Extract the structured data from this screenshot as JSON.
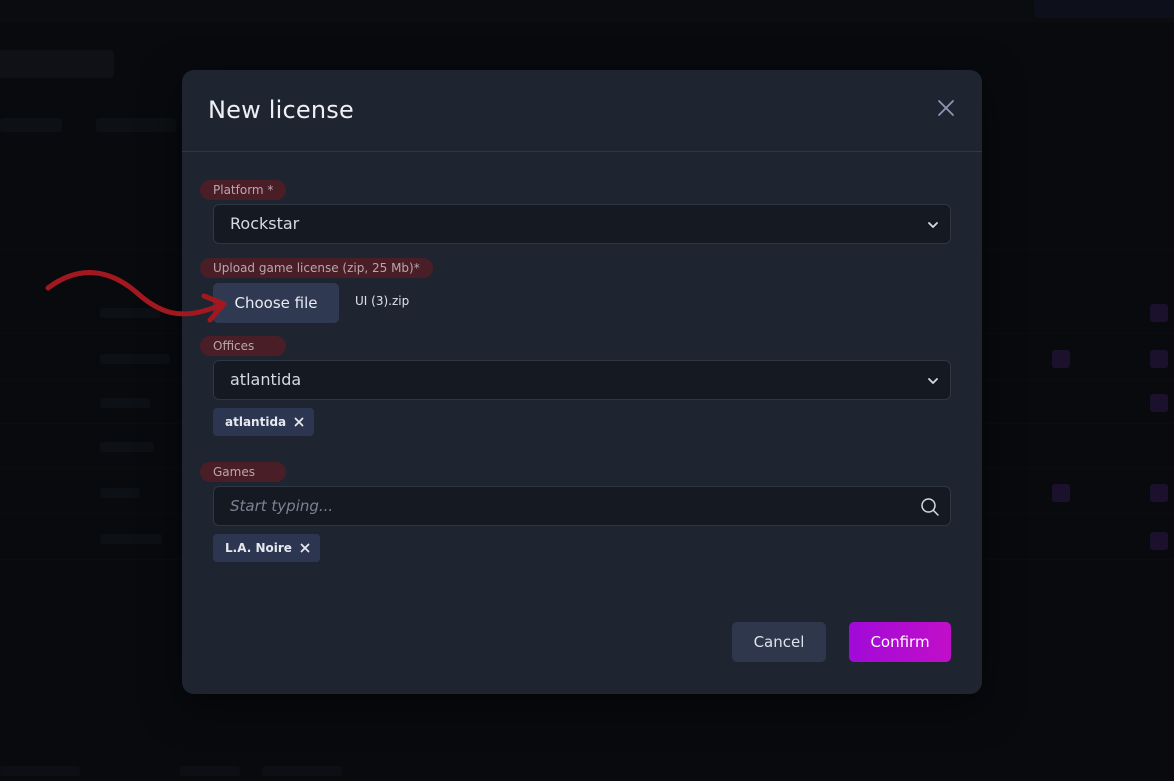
{
  "modal": {
    "title": "New license",
    "platform": {
      "label": "Platform *",
      "value": "Rockstar"
    },
    "upload": {
      "label": "Upload game license (zip, 25 Mb)*",
      "button_label": "Choose file",
      "file_name": "UI (3).zip"
    },
    "offices": {
      "label": "Offices",
      "value": "atlantida",
      "chips": [
        "atlantida"
      ]
    },
    "games": {
      "label": "Games",
      "placeholder": "Start typing...",
      "chips": [
        "L.A. Noire"
      ]
    },
    "actions": {
      "cancel_label": "Cancel",
      "confirm_label": "Confirm"
    }
  },
  "colors": {
    "accent": "#b40cd0",
    "label_bg": "#4a1e26",
    "annotation_arrow": "#a3181f"
  },
  "icons": [
    "close-icon",
    "chevron-down-icon",
    "search-icon",
    "remove-chip-icon",
    "annotation-arrow"
  ]
}
